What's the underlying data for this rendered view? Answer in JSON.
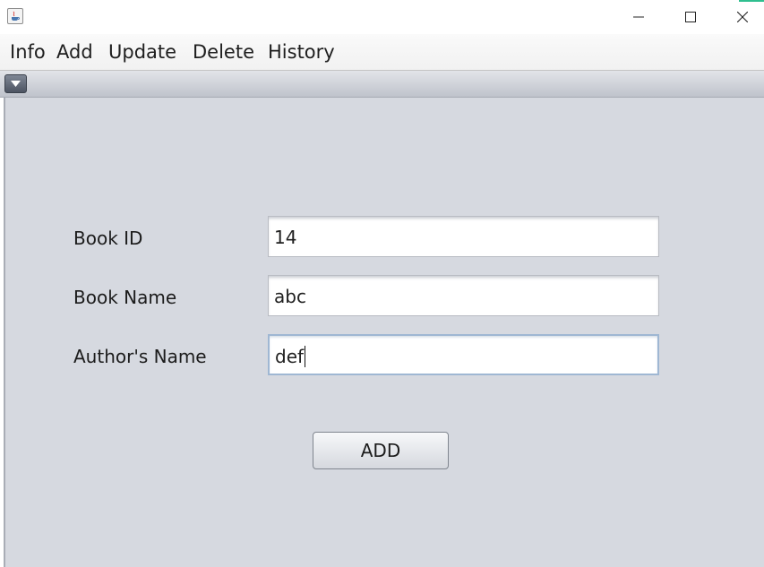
{
  "window": {
    "controls": {
      "minimize_icon": "minimize-icon",
      "maximize_icon": "maximize-icon",
      "close_icon": "close-icon"
    }
  },
  "menubar": {
    "items": [
      {
        "label": "Info"
      },
      {
        "label": "Add"
      },
      {
        "label": "Update"
      },
      {
        "label": "Delete"
      },
      {
        "label": "History"
      }
    ]
  },
  "form": {
    "book_id": {
      "label": "Book ID",
      "value": "14"
    },
    "book_name": {
      "label": "Book Name",
      "value": "abc"
    },
    "author_name": {
      "label": "Author's Name",
      "value": "def"
    },
    "add_button": {
      "label": "ADD"
    }
  },
  "colors": {
    "content_bg": "#d6d9e0",
    "focus_border": "#9fb7d3",
    "close_accent": "#2fbf8f"
  }
}
